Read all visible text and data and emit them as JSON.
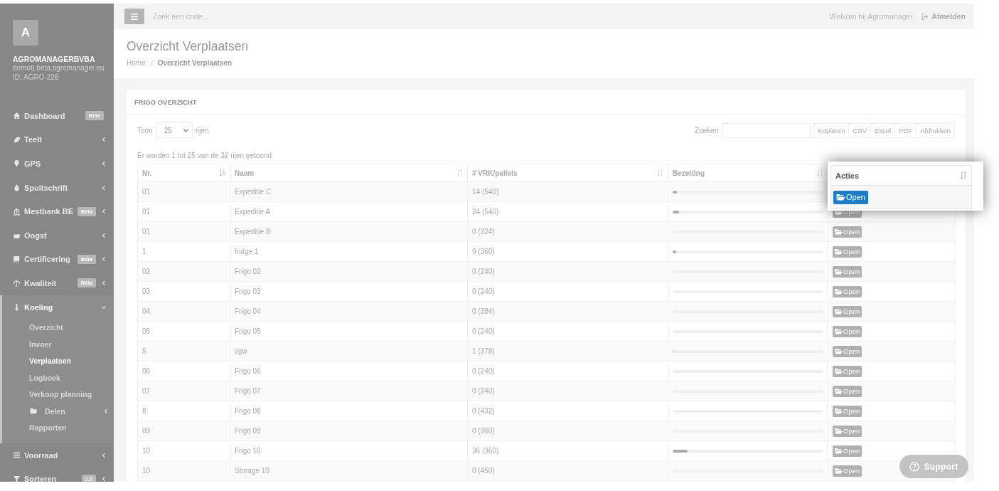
{
  "sidebar": {
    "logo_letter": "A",
    "company": "AGROMANAGERBVBA",
    "domain": "demo8.beta.agromanager.eu",
    "account_id": "ID: AGRO-228",
    "items": [
      {
        "label": "Dashboard",
        "badge": "Beta",
        "selected": false
      },
      {
        "label": "Teelt",
        "expanded": false,
        "selected": false
      },
      {
        "label": "GPS",
        "expanded": false,
        "selected": false
      },
      {
        "label": "Spuitschrift",
        "expanded": false,
        "selected": false
      },
      {
        "label": "Mestbank BE",
        "badge": "Bèta",
        "expanded": false,
        "selected": false
      },
      {
        "label": "Oogst",
        "expanded": false,
        "selected": false
      },
      {
        "label": "Certificering",
        "badge": "Bèta",
        "expanded": false,
        "selected": false
      },
      {
        "label": "Kwaliteit",
        "badge": "Bèta",
        "expanded": false,
        "selected": false
      },
      {
        "label": "Koeling",
        "expanded": true,
        "selected": true,
        "children": [
          {
            "label": "Overzicht",
            "selected": false
          },
          {
            "label": "Invoer",
            "selected": false
          },
          {
            "label": "Verplaatsen",
            "selected": true
          },
          {
            "label": "Logboek",
            "selected": false
          },
          {
            "label": "Verkoop planning",
            "selected": false
          },
          {
            "label": "Delen",
            "expanded": false,
            "selected": false
          },
          {
            "label": "Rapporten",
            "selected": false
          }
        ]
      },
      {
        "label": "Voorraad",
        "expanded": false,
        "selected": false
      },
      {
        "label": "Sorteren",
        "badge": "2.0",
        "expanded": false,
        "selected": false
      }
    ]
  },
  "topbar": {
    "search": {
      "placeholder": "Zoek een code..."
    },
    "welcome": "Welkom bij Agromanager.",
    "logout": "Afmelden"
  },
  "header": {
    "title": "Overzicht Verplaatsen",
    "breadcrumb": [
      "Home",
      "Overzicht Verplaatsen"
    ]
  },
  "panel": {
    "title": "FRIGO OVERZICHT",
    "length": {
      "before": "Toon",
      "value": "25",
      "after": "rijen"
    },
    "search_label": "Zoeken",
    "export_buttons": [
      "Kopieren",
      "CSV",
      "Excel",
      "PDF",
      "Afdrukken"
    ],
    "info": "Er worden 1 tot 25 van de 32 rijen getoond",
    "columns": [
      {
        "label": "Nr.",
        "sorted": true
      },
      {
        "label": "Naam",
        "sorted": false
      },
      {
        "label": "# VRK/pallets",
        "sorted": false
      },
      {
        "label": "Bezetting",
        "sorted": false
      }
    ],
    "rows": [
      {
        "nr": "01",
        "naam": "Expeditie C",
        "pallets": "14 (540)",
        "level": 0.026
      },
      {
        "nr": "01",
        "naam": "Expeditie A",
        "pallets": "24 (540)",
        "level": 0.044,
        "action": "Open"
      },
      {
        "nr": "01",
        "naam": "Expeditie B",
        "pallets": "0 (324)",
        "level": 0,
        "action": "Open"
      },
      {
        "nr": "1",
        "naam": "fridge 1",
        "pallets": "9 (360)",
        "level": 0.025,
        "action": "Open"
      },
      {
        "nr": "02",
        "naam": "Frigo 02",
        "pallets": "0 (240)",
        "level": 0,
        "action": "Open"
      },
      {
        "nr": "03",
        "naam": "Frigo 03",
        "pallets": "0 (240)",
        "level": 0,
        "action": "Open"
      },
      {
        "nr": "04",
        "naam": "Frigo 04",
        "pallets": "0 (384)",
        "level": 0,
        "action": "Open"
      },
      {
        "nr": "05",
        "naam": "Frigo 05",
        "pallets": "0 (240)",
        "level": 0,
        "action": "Open"
      },
      {
        "nr": "5",
        "naam": "sgw",
        "pallets": "1 (378)",
        "level": 0.003,
        "action": "Open"
      },
      {
        "nr": "06",
        "naam": "Frigo 06",
        "pallets": "0 (240)",
        "level": 0,
        "action": "Open"
      },
      {
        "nr": "07",
        "naam": "Frigo 07",
        "pallets": "0 (240)",
        "level": 0,
        "action": "Open"
      },
      {
        "nr": "8",
        "naam": "Frigo 08",
        "pallets": "0 (432)",
        "level": 0,
        "action": "Open"
      },
      {
        "nr": "09",
        "naam": "Frigo 09",
        "pallets": "0 (360)",
        "level": 0,
        "action": "Open"
      },
      {
        "nr": "10",
        "naam": "Frigo 10",
        "pallets": "36 (360)",
        "level": 0.1,
        "action": "Open"
      },
      {
        "nr": "10",
        "naam": "Storage 10",
        "pallets": "0 (450)",
        "level": 0,
        "action": "Open"
      }
    ]
  },
  "spotlight": {
    "column": "Acties",
    "button": "Open"
  },
  "support": "Support"
}
